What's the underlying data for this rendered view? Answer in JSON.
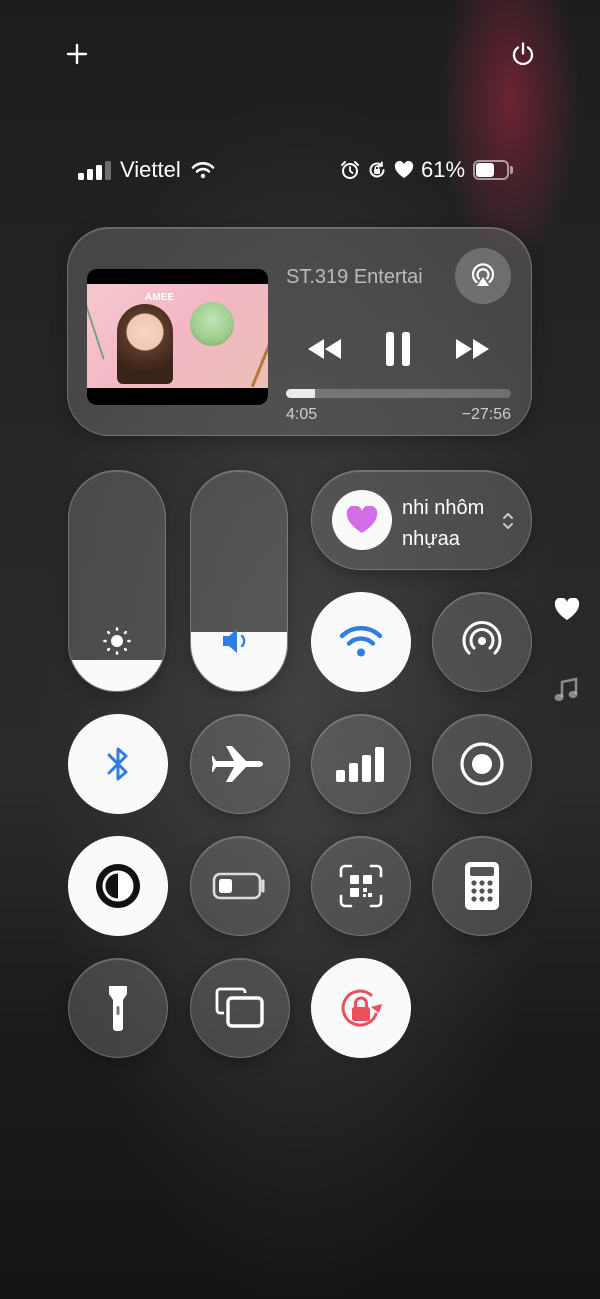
{
  "status_bar": {
    "carrier": "Viettel",
    "battery_percent": "61%",
    "battery_level": 0.61
  },
  "media": {
    "title": "ST.319 Entertai",
    "elapsed": "4:05",
    "remaining": "−27:56",
    "progress": 0.13,
    "album_art_text": "AMEE"
  },
  "sliders": {
    "brightness_level": 0.14,
    "volume_level": 0.27
  },
  "focus": {
    "label_line1": "nhi nhôm",
    "label_line2": "nhựaa"
  },
  "icons": {
    "add": "plus-icon",
    "power": "power-icon",
    "airplay": "airplay-audio-icon",
    "wifi": "wifi-icon",
    "bluetooth": "bluetooth-icon",
    "airplane": "airplane-icon",
    "cellular": "cellular-icon",
    "airdrop": "airdrop-icon",
    "record": "screen-record-icon",
    "dark_mode": "dark-mode-icon",
    "low_power": "low-power-icon",
    "code_scanner": "qr-scanner-icon",
    "calculator": "calculator-icon",
    "flashlight": "flashlight-icon",
    "mirroring": "screen-mirroring-icon",
    "rotation_lock": "rotation-lock-icon",
    "heart_page": "heart-icon",
    "music_page": "music-note-icon"
  },
  "colors": {
    "accent_blue": "#2f7de1",
    "heart_purple": "#d46ee8",
    "rotation_red": "#ea4f5c",
    "tile_on": "#fafafa"
  }
}
